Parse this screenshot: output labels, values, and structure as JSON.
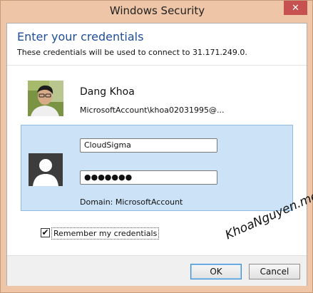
{
  "window": {
    "title": "Windows Security",
    "close_glyph": "✕",
    "accent_color": "#eec5a6"
  },
  "header": {
    "heading": "Enter your credentials",
    "subtext": "These credentials will be used to connect to 31.171.249.0."
  },
  "saved_account": {
    "name": "Dang Khoa",
    "id": "MicrosoftAccount\\khoa02031995@..."
  },
  "credential_tile": {
    "username_value": "CloudSigma",
    "password_value": "●●●●●●●",
    "domain": "Domain: MicrosoftAccount"
  },
  "remember": {
    "label": "Remember my credentials",
    "checked": true,
    "check_glyph": "✔"
  },
  "buttons": {
    "ok": "OK",
    "cancel": "Cancel"
  },
  "watermark": "KhoaNguyen.me"
}
